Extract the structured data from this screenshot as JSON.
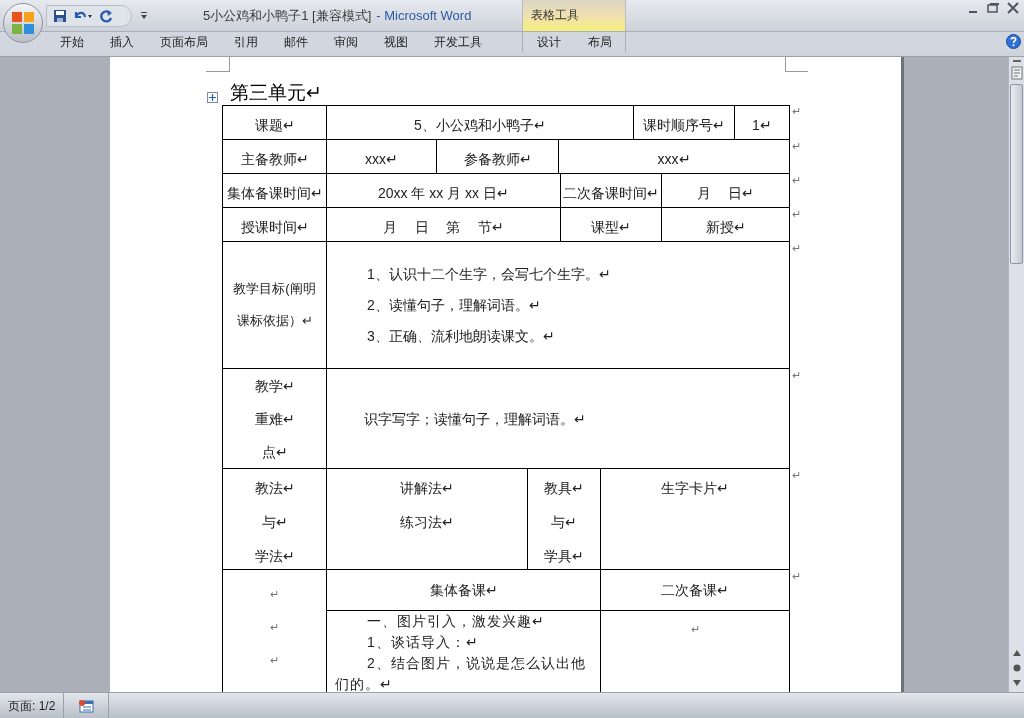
{
  "window": {
    "title": "5小公鸡和小鸭子1 [兼容模式]",
    "app_name": "- Microsoft Word",
    "contextual_group": "表格工具"
  },
  "ribbon_tabs": [
    {
      "label": "开始",
      "selected": false,
      "contextual": false
    },
    {
      "label": "插入",
      "selected": false,
      "contextual": false
    },
    {
      "label": "页面布局",
      "selected": false,
      "contextual": false
    },
    {
      "label": "引用",
      "selected": false,
      "contextual": false
    },
    {
      "label": "邮件",
      "selected": false,
      "contextual": false
    },
    {
      "label": "审阅",
      "selected": false,
      "contextual": false
    },
    {
      "label": "视图",
      "selected": false,
      "contextual": false
    },
    {
      "label": "开发工具",
      "selected": false,
      "contextual": false
    },
    {
      "label": "设计",
      "selected": false,
      "contextual": true
    },
    {
      "label": "布局",
      "selected": false,
      "contextual": true
    }
  ],
  "document": {
    "heading": "第三单元↵",
    "form_lines": [
      {
        "fields": [
          {
            "lines": [
              "课题↵"
            ]
          },
          {
            "lines": [
              "5、小公鸡和小鸭子↵"
            ]
          },
          {
            "lines": [
              "课时顺序号↵"
            ]
          },
          {
            "lines": [
              "1↵"
            ]
          }
        ],
        "end_mark": "↵"
      },
      {
        "fields": [
          {
            "lines": [
              "主备教师↵"
            ]
          },
          {
            "lines": [
              "xxx↵"
            ]
          },
          {
            "lines": [
              "参备教师↵"
            ]
          },
          {
            "lines": [
              "xxx↵"
            ]
          }
        ],
        "end_mark": "↵"
      },
      {
        "fields": [
          {
            "lines": [
              "集体备课时间↵"
            ]
          },
          {
            "lines": [
              "20xx 年 xx 月 xx 日↵"
            ]
          },
          {
            "lines": [
              "二次备课时间↵"
            ]
          },
          {
            "lines": [
              "月　 日↵"
            ]
          }
        ],
        "end_mark": "↵"
      },
      {
        "fields": [
          {
            "lines": [
              "授课时间↵"
            ]
          },
          {
            "lines": [
              "月　 日　 第　 节↵"
            ]
          },
          {
            "lines": [
              "课型↵"
            ]
          },
          {
            "lines": [
              "新授↵"
            ]
          }
        ],
        "end_mark": "↵"
      },
      {
        "fields": [
          {
            "lines": [
              "教学目标(阐明",
              "课标依据）↵"
            ]
          },
          {
            "lines": [
              "1、认识十二个生字，会写七个生字。↵",
              "2、读懂句子，理解词语。↵",
              "3、正确、流利地朗读课文。↵"
            ]
          }
        ],
        "end_mark": "↵"
      },
      {
        "fields": [
          {
            "lines": [
              "教学↵",
              "重难↵",
              "点↵"
            ]
          },
          {
            "lines": [
              "识字写字；读懂句子，理解词语。↵"
            ]
          }
        ],
        "end_mark": "↵"
      },
      {
        "fields": [
          {
            "lines": [
              "教法↵",
              "与↵",
              "学法↵"
            ]
          },
          {
            "lines": [
              "讲解法↵",
              "练习法↵"
            ]
          },
          {
            "lines": [
              "教具↵",
              "与↵",
              "学具↵"
            ]
          },
          {
            "lines": [
              "生字卡片↵"
            ]
          }
        ],
        "end_mark": "↵"
      }
    ],
    "lesson": {
      "side": [
        "↵",
        "↵",
        "↵"
      ],
      "header": [
        {
          "lines": [
            "集体备课↵"
          ]
        },
        {
          "lines": [
            "二次备课↵"
          ]
        }
      ],
      "header_end_mark": "↵",
      "body": [
        {
          "lines": [
            "一、图片引入，激发兴趣↵",
            "1、谈话导入：↵",
            "2、结合图片，说说是怎么认出他们的。↵"
          ]
        },
        {
          "lines": [
            "↵"
          ]
        }
      ]
    }
  },
  "status_bar": {
    "page": "页面: 1/2"
  }
}
